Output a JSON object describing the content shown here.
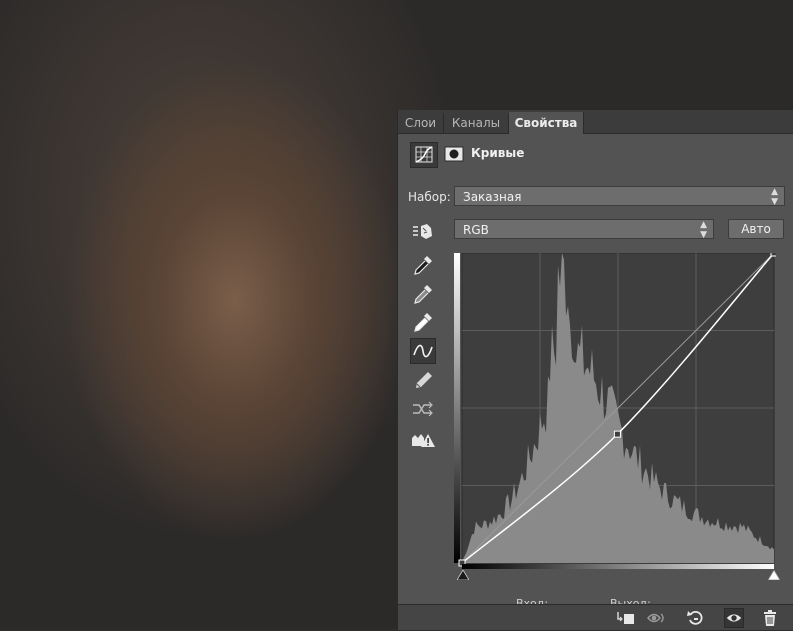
{
  "tabs": [
    {
      "label": "Слои",
      "active": false
    },
    {
      "label": "Каналы",
      "active": false
    },
    {
      "label": "Свойства",
      "active": true
    }
  ],
  "properties": {
    "title": "Кривые",
    "preset_label": "Набор:",
    "preset_value": "Заказная",
    "channel_value": "RGB",
    "auto_button": "Авто",
    "lower_labels": [
      "Вход:",
      "Выход:"
    ]
  },
  "tools": [
    {
      "icon": "target-adjust-icon",
      "active": false
    },
    {
      "icon": "black-point-eyedropper-icon",
      "active": false
    },
    {
      "icon": "gray-point-eyedropper-icon",
      "active": false
    },
    {
      "icon": "white-point-eyedropper-icon",
      "active": false
    },
    {
      "icon": "curve-edit-icon",
      "active": true
    },
    {
      "icon": "pencil-draw-icon",
      "active": false
    },
    {
      "icon": "smooth-curve-icon",
      "active": false
    },
    {
      "icon": "clipping-warning-icon",
      "active": false
    }
  ],
  "curve": {
    "input_range": [
      0,
      255
    ],
    "output_range": [
      0,
      255
    ],
    "points": [
      [
        0,
        0
      ],
      [
        127,
        106
      ],
      [
        255,
        255
      ]
    ]
  },
  "bottom_icons": [
    "clip-to-layer-icon",
    "view-previous-state-icon",
    "reset-icon",
    "visibility-eye-icon",
    "delete-trash-icon"
  ],
  "colors": {
    "panel": "#535353",
    "curve": "#ffffff",
    "histogram": "#8a8a8a"
  }
}
